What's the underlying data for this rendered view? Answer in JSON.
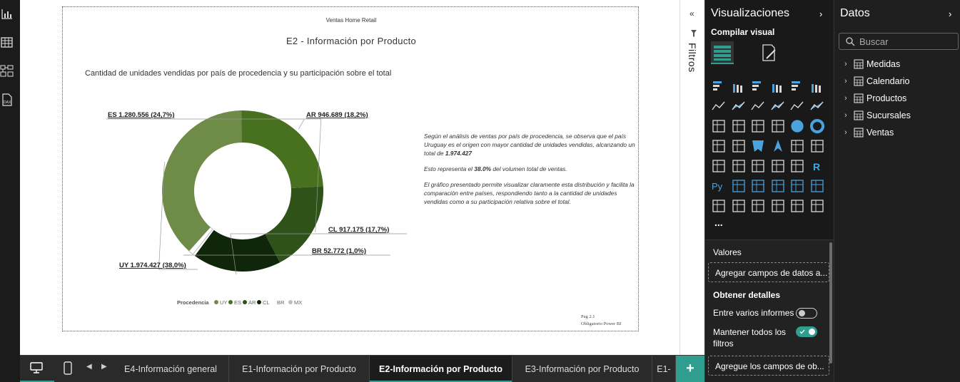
{
  "report": {
    "header_sub": "Ventas Home Retail",
    "page_title": "E2 - Información por Producto",
    "chart_title": "Cantidad de unidades vendidas por país de procedencia y su participación sobre el total",
    "footer_line1": "Pag 2.1",
    "footer_line2": "Obligatorio Power BI"
  },
  "analysis": {
    "p1_a": "Según el análisis de ventas por país de procedencia, se observa que el país Uruguay es el origen con mayor cantidad de unidades vendidas, alcanzando un total de ",
    "p1_b": "1.974.427",
    "p2_a": "Esto representa el ",
    "p2_b": "38.0%",
    "p2_c": " del volumen total de ventas.",
    "p3": "El gráfico presentado permite visualizar claramente esta distribución y facilita la comparación entre países, respondiendo tanto a la cantidad de unidades vendidas como a su participación relativa sobre el total."
  },
  "chart_data": {
    "type": "pie",
    "subtype": "donut",
    "legend_title": "Procedencia",
    "legend_position": "bottom",
    "slices": [
      {
        "name": "UY",
        "value": 1974427,
        "percent": 38.0,
        "label": "UY 1.974.427 (38,0%)",
        "color": "#6e8b47"
      },
      {
        "name": "ES",
        "value": 1280556,
        "percent": 24.7,
        "label": "ES 1.280.556 (24,7%)",
        "color": "#47701f"
      },
      {
        "name": "AR",
        "value": 946689,
        "percent": 18.2,
        "label": "AR 946.689 (18,2%)",
        "color": "#2f5219"
      },
      {
        "name": "CL",
        "value": 917175,
        "percent": 17.7,
        "label": "CL 917.175 (17,7%)",
        "color": "#0f260b"
      },
      {
        "name": "BR",
        "value": 52772,
        "percent": 1.0,
        "label": "BR 52.772 (1,0%)",
        "color": "#ffffff"
      },
      {
        "name": "MX",
        "value": 0,
        "percent": 0.0,
        "label": "",
        "color": "#bdbdbd"
      }
    ]
  },
  "filters_label": "Filtros",
  "viz_pane": {
    "title": "Visualizaciones",
    "build_label": "Compilar visual",
    "more": "...",
    "values_label": "Valores",
    "values_drop": "Agregar campos de datos a...",
    "drill_label": "Obtener detalles",
    "cross_report_label": "Entre varios informes",
    "keep_filters_label": "Mantener todos los filtros",
    "drill_drop": "Agregue los campos de ob...",
    "cross_report_state": "Desactivado",
    "keep_filters_state": "Activado"
  },
  "data_pane": {
    "title": "Datos",
    "search_placeholder": "Buscar",
    "tables": [
      "Medidas",
      "Calendario",
      "Productos",
      "Sucursales",
      "Ventas"
    ]
  },
  "tabs": {
    "items": [
      "E4-Información general",
      "E1-Información por Producto",
      "E2-Información por Producto",
      "E3-Información por Producto",
      "E1-"
    ],
    "active_index": 2
  },
  "colors": {
    "accent": "#2f9e8f"
  }
}
